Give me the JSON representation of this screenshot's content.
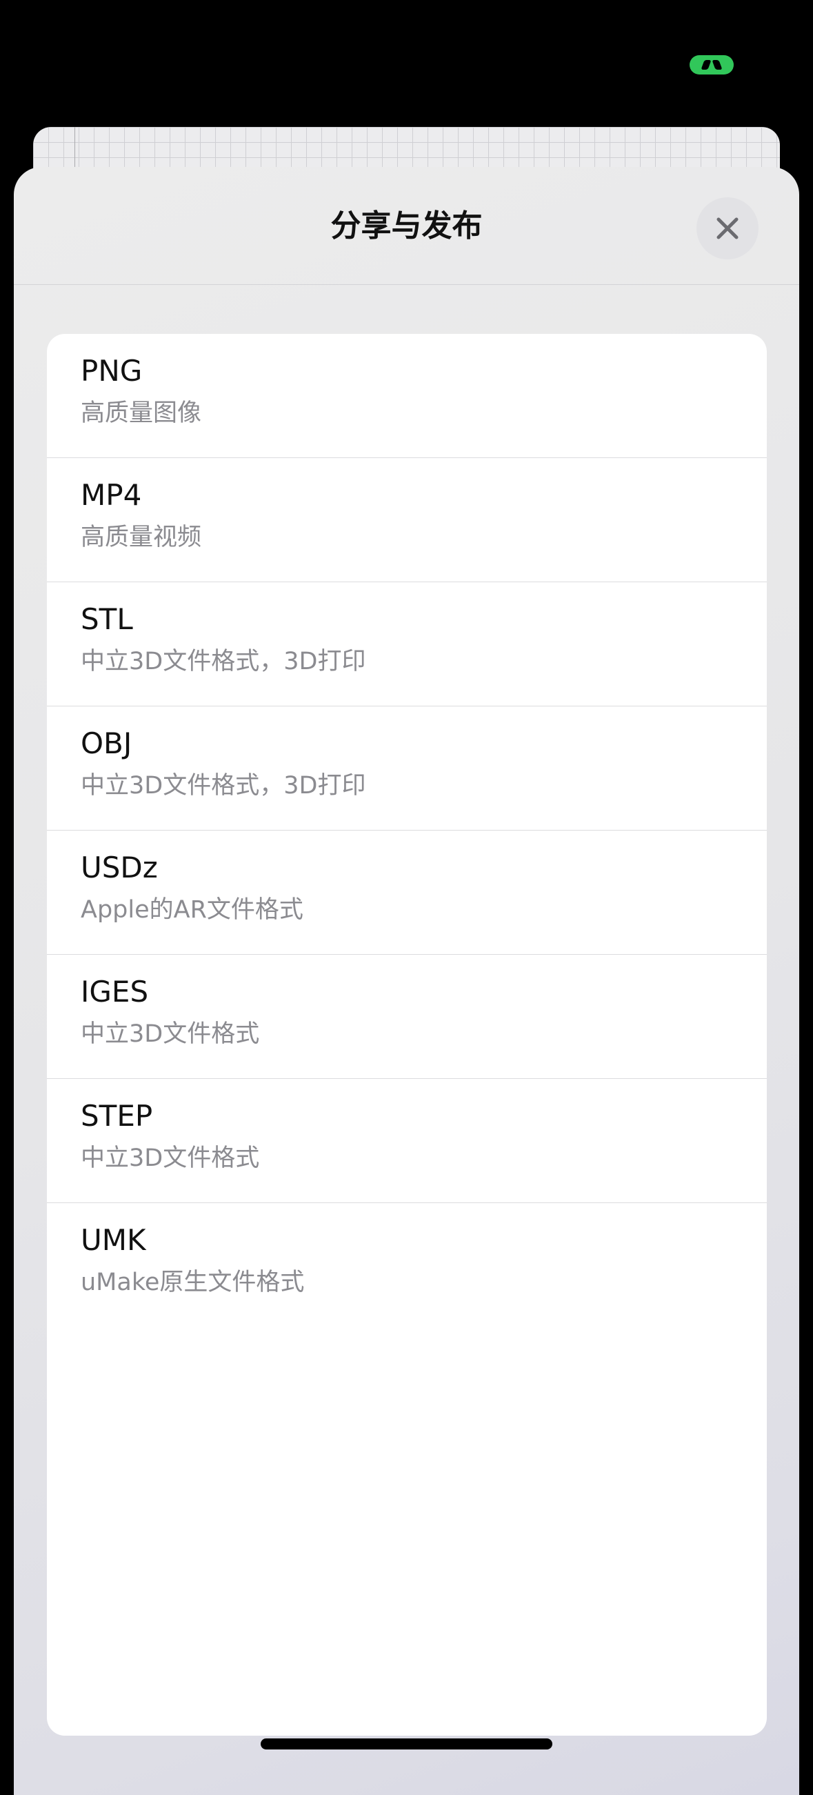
{
  "sheet": {
    "title": "分享与发布",
    "close_icon": "close-icon"
  },
  "export_options": [
    {
      "title": "PNG",
      "subtitle": "高质量图像"
    },
    {
      "title": "MP4",
      "subtitle": "高质量视频"
    },
    {
      "title": "STL",
      "subtitle": "中立3D文件格式，3D打印"
    },
    {
      "title": "OBJ",
      "subtitle": "中立3D文件格式，3D打印"
    },
    {
      "title": "USDz",
      "subtitle": "Apple的AR文件格式"
    },
    {
      "title": "IGES",
      "subtitle": "中立3D文件格式"
    },
    {
      "title": "STEP",
      "subtitle": "中立3D文件格式"
    },
    {
      "title": "UMK",
      "subtitle": "uMake原生文件格式"
    }
  ],
  "colors": {
    "status_indicator": "#31c75a",
    "title_text": "#111111",
    "subtitle_text": "#8b8b90",
    "card_background": "#ffffff"
  }
}
